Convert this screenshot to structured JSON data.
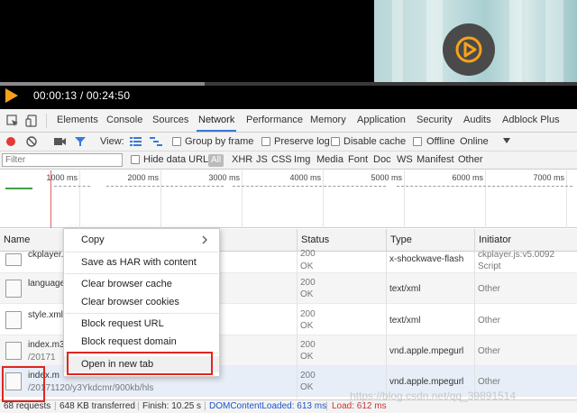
{
  "player": {
    "time": "00:00:13 / 00:24:50",
    "progress_fraction": 0.354,
    "icons": [
      "play-icon",
      "big-play-icon"
    ],
    "accent_color": "#f7a21b"
  },
  "devtools": {
    "tabs": [
      "Elements",
      "Console",
      "Sources",
      "Network",
      "Performance",
      "Memory",
      "Application",
      "Security",
      "Audits",
      "Adblock Plus"
    ],
    "active_tab": "Network",
    "toolbar": {
      "view_label": "View:",
      "group_by_frame": "Group by frame",
      "preserve_log": "Preserve log",
      "disable_cache": "Disable cache",
      "offline": "Offline",
      "online": "Online"
    },
    "filter": {
      "placeholder": "Filter",
      "hide_data_urls": "Hide data URLs",
      "all": "All",
      "types": [
        "XHR",
        "JS",
        "CSS",
        "Img",
        "Media",
        "Font",
        "Doc",
        "WS",
        "Manifest",
        "Other"
      ]
    },
    "timeline": {
      "ticks": [
        "1000 ms",
        "2000 ms",
        "3000 ms",
        "4000 ms",
        "5000 ms",
        "6000 ms",
        "7000 ms"
      ]
    },
    "table": {
      "headers": [
        "Name",
        "Status",
        "Type",
        "Initiator"
      ],
      "rows": [
        {
          "name": "ckplayer.",
          "path": "",
          "status": "200",
          "status_text": "OK",
          "type": "x-shockwave-flash",
          "initiator": "ckplayer.js:v5.0092",
          "initiator_sub": "Script"
        },
        {
          "name": "language",
          "path": "",
          "status": "200",
          "status_text": "OK",
          "type": "text/xml",
          "initiator": "Other",
          "initiator_sub": ""
        },
        {
          "name": "style.xml",
          "path": "",
          "status": "200",
          "status_text": "OK",
          "type": "text/xml",
          "initiator": "Other",
          "initiator_sub": ""
        },
        {
          "name": "index.m3",
          "path": "/20171",
          "status": "200",
          "status_text": "OK",
          "type": "vnd.apple.mpegurl",
          "initiator": "Other",
          "initiator_sub": ""
        },
        {
          "name": "index.m",
          "path": "/20171120/y3Ykdcmr/900kb/hls",
          "status": "200",
          "status_text": "OK",
          "type": "vnd.apple.mpegurl",
          "initiator": "Other",
          "initiator_sub": ""
        }
      ]
    },
    "statusbar": {
      "requests": "68 requests",
      "transferred": "648 KB transferred",
      "finish": "Finish: 10.25 s",
      "dom_loaded": "DOMContentLoaded: 613 ms",
      "load": "Load: 612 ms"
    },
    "context_menu": {
      "items": [
        "Copy",
        "Save as HAR with content",
        "Clear browser cache",
        "Clear browser cookies",
        "Block request URL",
        "Block request domain",
        "Open in new tab"
      ]
    }
  },
  "watermark": "https://blog.csdn.net/qq_39891514"
}
